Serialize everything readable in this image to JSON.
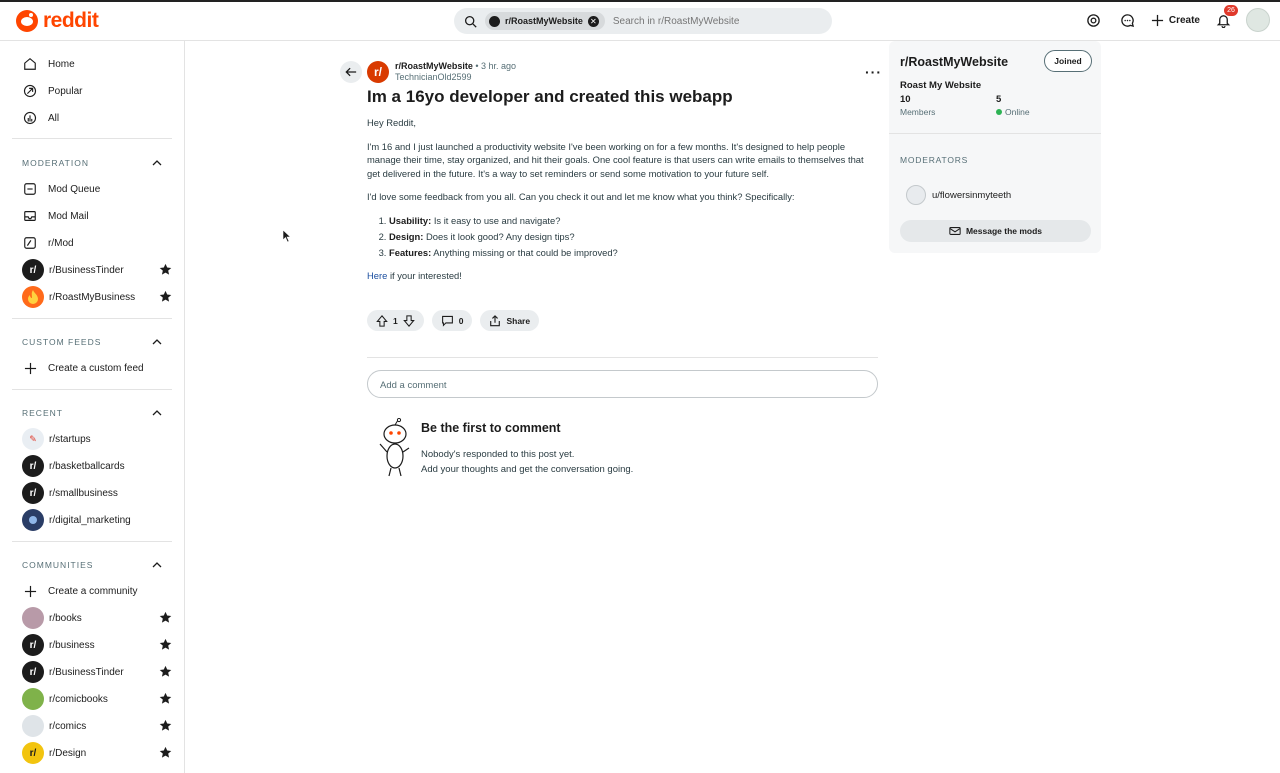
{
  "brand": {
    "name": "reddit",
    "accent": "#ff4500"
  },
  "search": {
    "chip": "r/RoastMyWebsite",
    "placeholder": "Search in r/RoastMyWebsite"
  },
  "header": {
    "create_label": "Create",
    "notification_count": "26"
  },
  "sidebar": {
    "main": [
      {
        "label": "Home",
        "icon": "home-icon"
      },
      {
        "label": "Popular",
        "icon": "popular-icon"
      },
      {
        "label": "All",
        "icon": "all-icon"
      }
    ],
    "moderation": {
      "heading": "MODERATION",
      "items": [
        {
          "label": "Mod Queue",
          "icon": "mod-queue-icon"
        },
        {
          "label": "Mod Mail",
          "icon": "mod-mail-icon"
        },
        {
          "label": "r/Mod",
          "icon": "mod-icon"
        },
        {
          "label": "r/BusinessTinder",
          "color": "#1c1c1c",
          "starred": true
        },
        {
          "label": "r/RoastMyBusiness",
          "color": "#ff6a1a",
          "starred": true
        }
      ]
    },
    "custom_feeds": {
      "heading": "CUSTOM FEEDS",
      "items": [
        {
          "label": "Create a custom feed"
        }
      ]
    },
    "recent": {
      "heading": "RECENT",
      "items": [
        {
          "label": "r/startups",
          "color": "#e9eef3"
        },
        {
          "label": "r/basketballcards",
          "color": "#1c1c1c"
        },
        {
          "label": "r/smallbusiness",
          "color": "#1c1c1c"
        },
        {
          "label": "r/digital_marketing",
          "color": "#2a3d66"
        }
      ]
    },
    "communities": {
      "heading": "COMMUNITIES",
      "items": [
        {
          "label": "Create a community"
        },
        {
          "label": "r/books",
          "color": "#b89aa8",
          "starred": true
        },
        {
          "label": "r/business",
          "color": "#1c1c1c",
          "starred": true
        },
        {
          "label": "r/BusinessTinder",
          "color": "#1c1c1c",
          "starred": true
        },
        {
          "label": "r/comicbooks",
          "color": "#7fb24a",
          "starred": true
        },
        {
          "label": "r/comics",
          "color": "#dfe4e8",
          "starred": true
        },
        {
          "label": "r/Design",
          "color": "#f2c40f",
          "starred": true
        }
      ]
    }
  },
  "post": {
    "subreddit": "r/RoastMyWebsite",
    "time": "3 hr. ago",
    "author": "TechnicianOld2599",
    "title": "Im a 16yo developer and created this webapp",
    "greeting": "Hey Reddit,",
    "para1": "I'm 16 and I just launched a productivity website I've been working on for a few months. It's designed to help people manage their time, stay organized, and hit their goals. One cool feature is that users can write emails to themselves that get delivered in the future. It's a way to set reminders or send some motivation to your future self.",
    "para2": "I'd love some feedback from you all. Can you check it out and let me know what you think? Specifically:",
    "list": [
      {
        "bold": "Usability:",
        "text": "Is it easy to use and navigate?"
      },
      {
        "bold": "Design:",
        "text": "Does it look good? Any design tips?"
      },
      {
        "bold": "Features:",
        "text": "Anything missing or that could be improved?"
      }
    ],
    "link_text": "Here",
    "closing": "if your interested!",
    "votes": "1",
    "comments": "0",
    "share_label": "Share"
  },
  "comments": {
    "placeholder": "Add a comment",
    "empty_title": "Be the first to comment",
    "empty_line1": "Nobody's responded to this post yet.",
    "empty_line2": "Add your thoughts and get the conversation going."
  },
  "community": {
    "title": "r/RoastMyWebsite",
    "joined_label": "Joined",
    "name": "Roast My Website",
    "members": "10",
    "members_label": "Members",
    "online": "5",
    "online_label": "Online",
    "moderators_heading": "MODERATORS",
    "moderator": "u/flowersinmyteeth",
    "message_label": "Message the mods"
  }
}
